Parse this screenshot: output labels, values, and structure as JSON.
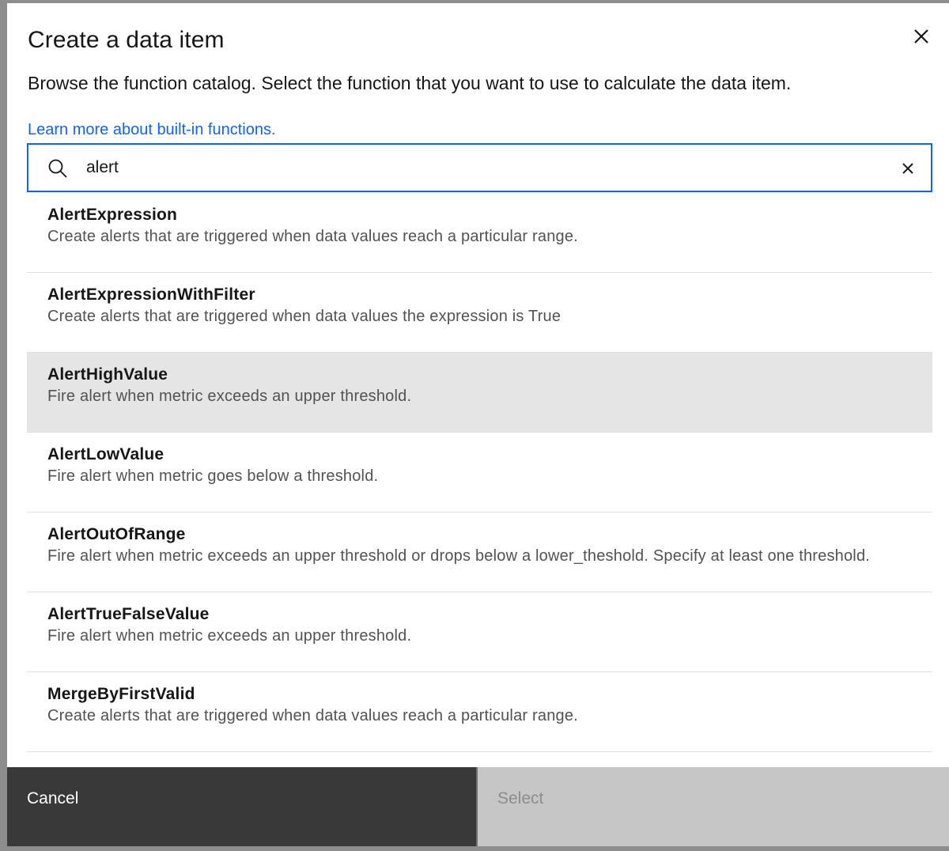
{
  "modal": {
    "title": "Create a data item",
    "description": "Browse the function catalog. Select the function that you want to use to calculate the data item.",
    "learn_more_link": "Learn more about built-in functions."
  },
  "search": {
    "value": "alert",
    "icon": "search-icon",
    "clear_icon": "close-icon"
  },
  "functions": [
    {
      "name": "AlertExpression",
      "description": "Create alerts that are triggered when data values reach a particular range."
    },
    {
      "name": "AlertExpressionWithFilter",
      "description": "Create alerts that are triggered when data values the expression is True"
    },
    {
      "name": "AlertHighValue",
      "description": "Fire alert when metric exceeds an upper threshold.",
      "hovered": true
    },
    {
      "name": "AlertLowValue",
      "description": "Fire alert when metric goes below a threshold."
    },
    {
      "name": "AlertOutOfRange",
      "description": "Fire alert when metric exceeds an upper threshold or drops below a lower_theshold. Specify at least one threshold."
    },
    {
      "name": "AlertTrueFalseValue",
      "description": "Fire alert when metric exceeds an upper threshold."
    },
    {
      "name": "MergeByFirstValid",
      "description": "Create alerts that are triggered when data values reach a particular range."
    }
  ],
  "footer": {
    "cancel_label": "Cancel",
    "select_label": "Select"
  },
  "colors": {
    "primary": "#0f62fe",
    "hover_row": "#e5e5e5",
    "secondary_button": "#393939",
    "disabled_button": "#c6c6c6"
  }
}
